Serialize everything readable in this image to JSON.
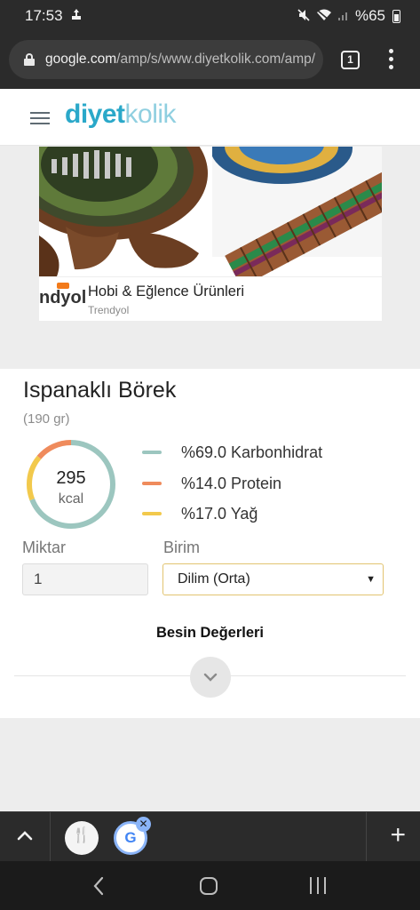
{
  "status_bar": {
    "time": "17:53",
    "battery": "%65",
    "icons": [
      "notification-icon",
      "mute-icon",
      "wifi-icon",
      "signal-icon",
      "battery-icon"
    ]
  },
  "browser": {
    "url_host": "google.com",
    "url_path": "/amp/s/www.diyetkolik.com/amp/",
    "tab_count": "1"
  },
  "site": {
    "logo_part1": "diyet",
    "logo_part2": "kolik",
    "colors": {
      "logo_dark": "#2aa8c9",
      "logo_light": "#8fcfe0"
    }
  },
  "ad": {
    "brand_logo": "ndyol",
    "title": "Hobi & Eğlence Ürünleri",
    "subtitle": "Trendyol"
  },
  "food": {
    "title": "Ispanaklı Börek",
    "portion": "(190 gr)",
    "kcal_value": "295",
    "kcal_unit": "kcal",
    "macros": [
      {
        "label": "%69.0 Karbonhidrat",
        "percent": 69.0,
        "color": "#9cc6bf"
      },
      {
        "label": "%14.0 Protein",
        "percent": 14.0,
        "color": "#ef8b5c"
      },
      {
        "label": "%17.0 Yağ",
        "percent": 17.0,
        "color": "#f2c94c"
      }
    ],
    "quantity_label": "Miktar",
    "quantity_value": "1",
    "unit_label": "Birim",
    "unit_selected": "Dilim (Orta)",
    "nutrition_heading": "Besin Değerleri"
  },
  "tab_strip": {
    "tabs": [
      {
        "name": "tab-thumb-recipe",
        "glyph": "🍴"
      },
      {
        "name": "tab-thumb-google",
        "glyph": "G"
      }
    ]
  }
}
